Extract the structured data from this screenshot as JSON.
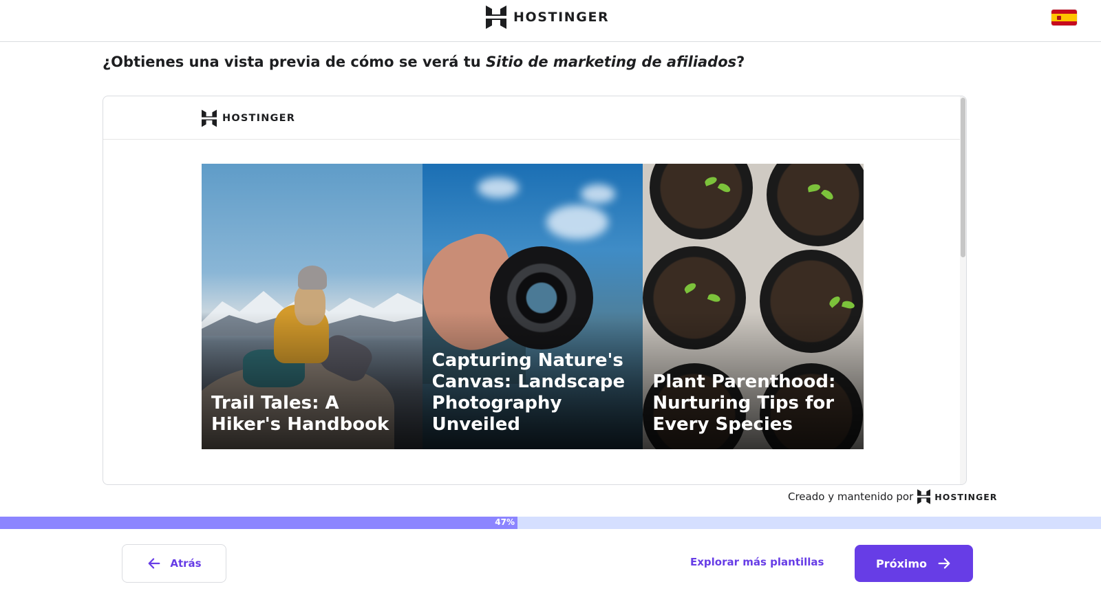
{
  "header": {
    "brand_name": "HOSTINGER",
    "language_flag": "spain-flag-icon"
  },
  "heading": {
    "prefix": "¿Obtienes una vista previa de cómo se verá tu ",
    "site_type": "Sitio de marketing de afiliados",
    "suffix": "?"
  },
  "preview": {
    "brand_name": "HOSTINGER",
    "cards": [
      {
        "title": "Trail Tales: A Hiker's Handbook"
      },
      {
        "title": "Capturing Nature's Canvas: Landscape Photography Unveiled"
      },
      {
        "title": "Plant Parenthood: Nurturing Tips for Every Species"
      }
    ]
  },
  "credit": {
    "text": "Creado y mantenido por",
    "brand_name": "HOSTINGER"
  },
  "progress": {
    "percent": 47,
    "label": "47%"
  },
  "footer": {
    "back_label": "Atrás",
    "explore_label": "Explorar más plantillas",
    "next_label": "Próximo"
  },
  "colors": {
    "accent": "#673de6",
    "progress_fill": "#8c85ff",
    "progress_track": "#d5dfff"
  }
}
